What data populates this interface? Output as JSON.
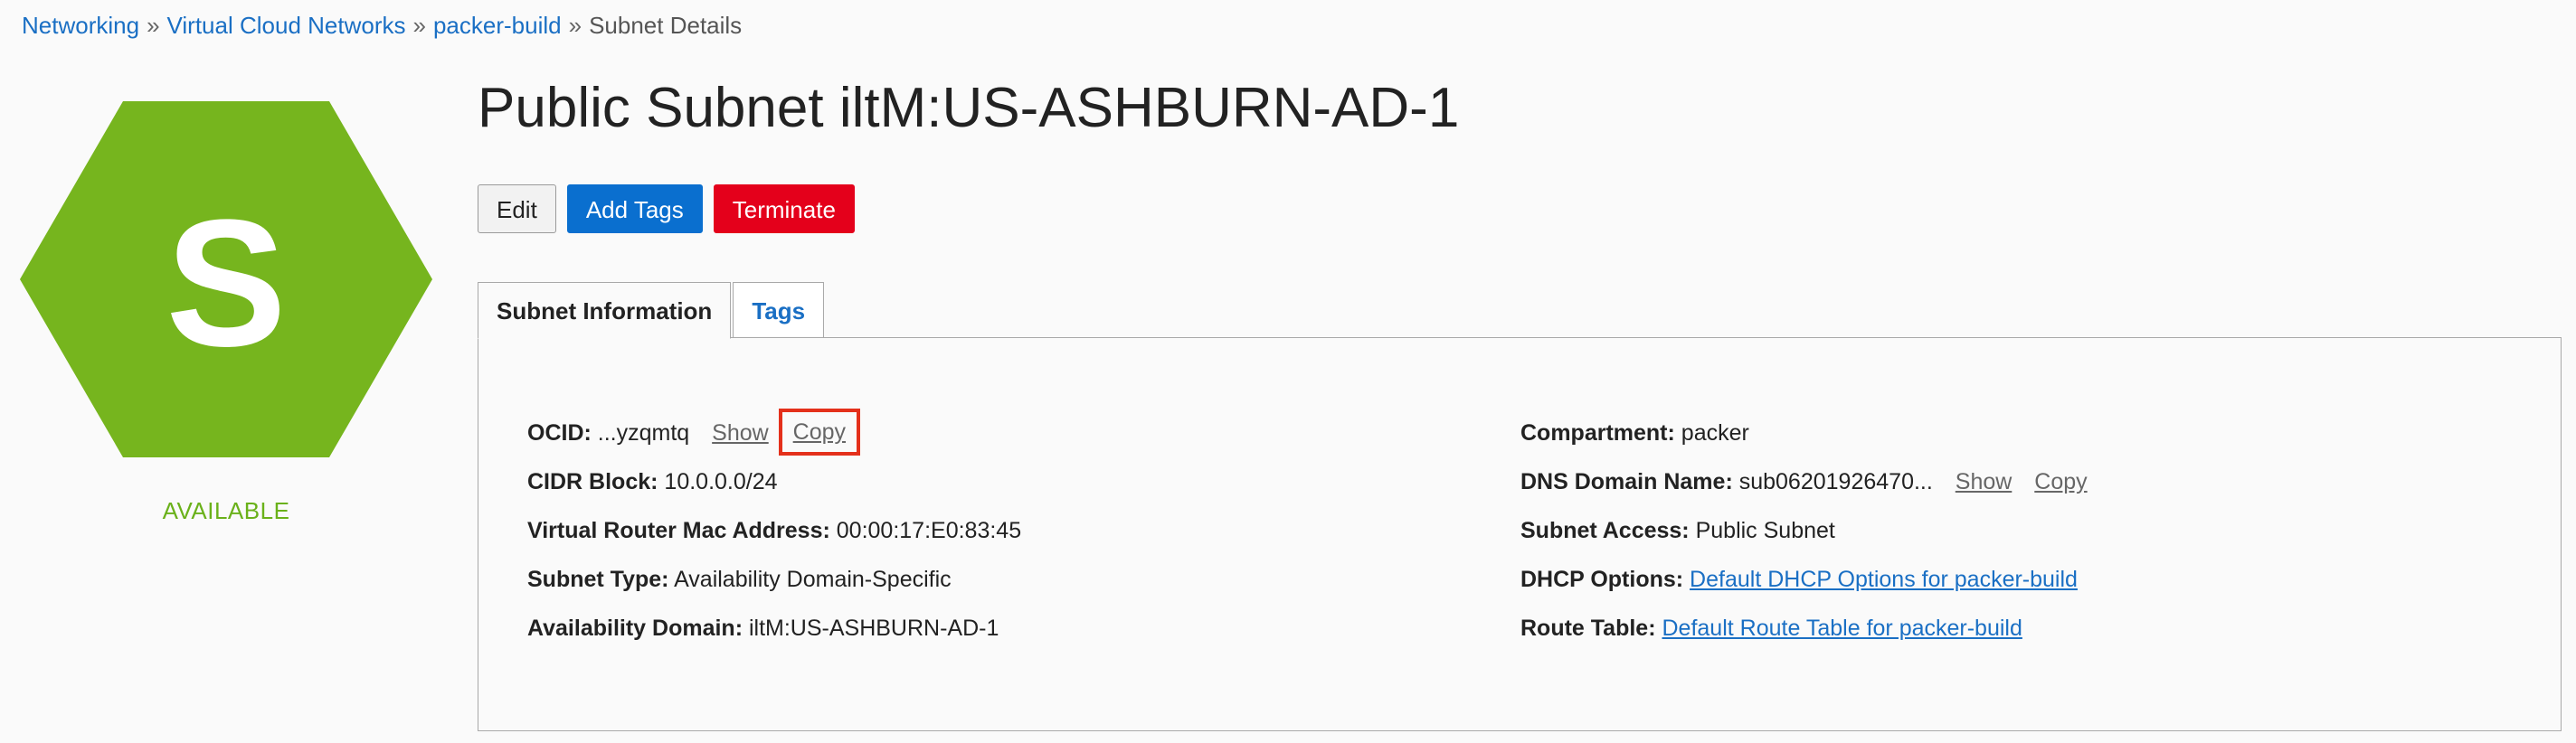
{
  "breadcrumb": {
    "items": [
      "Networking",
      "Virtual Cloud Networks",
      "packer-build"
    ],
    "separator": "»",
    "current": "Subnet Details"
  },
  "resource": {
    "letter": "S",
    "status": "AVAILABLE",
    "status_color": "#6ab11a",
    "hex_color": "#76b51e",
    "title": "Public Subnet iltM:US-ASHBURN-AD-1"
  },
  "actions": {
    "edit": "Edit",
    "add_tags": "Add Tags",
    "terminate": "Terminate"
  },
  "tabs": [
    {
      "label": "Subnet Information",
      "active": true
    },
    {
      "label": "Tags",
      "active": false
    }
  ],
  "info": {
    "ocid": {
      "label": "OCID:",
      "value": "...yzqmtq",
      "show": "Show",
      "copy": "Copy"
    },
    "cidr": {
      "label": "CIDR Block:",
      "value": "10.0.0.0/24"
    },
    "vr_mac": {
      "label": "Virtual Router Mac Address:",
      "value": "00:00:17:E0:83:45"
    },
    "subnet_type": {
      "label": "Subnet Type:",
      "value": "Availability Domain-Specific"
    },
    "ad": {
      "label": "Availability Domain:",
      "value": "iltM:US-ASHBURN-AD-1"
    },
    "compartment": {
      "label": "Compartment:",
      "value": "packer"
    },
    "dns": {
      "label": "DNS Domain Name:",
      "value": "sub06201926470...",
      "show": "Show",
      "copy": "Copy"
    },
    "access": {
      "label": "Subnet Access:",
      "value": "Public Subnet"
    },
    "dhcp": {
      "label": "DHCP Options:",
      "value": "Default DHCP Options for packer-build"
    },
    "route": {
      "label": "Route Table:",
      "value": "Default Route Table for packer-build"
    }
  }
}
